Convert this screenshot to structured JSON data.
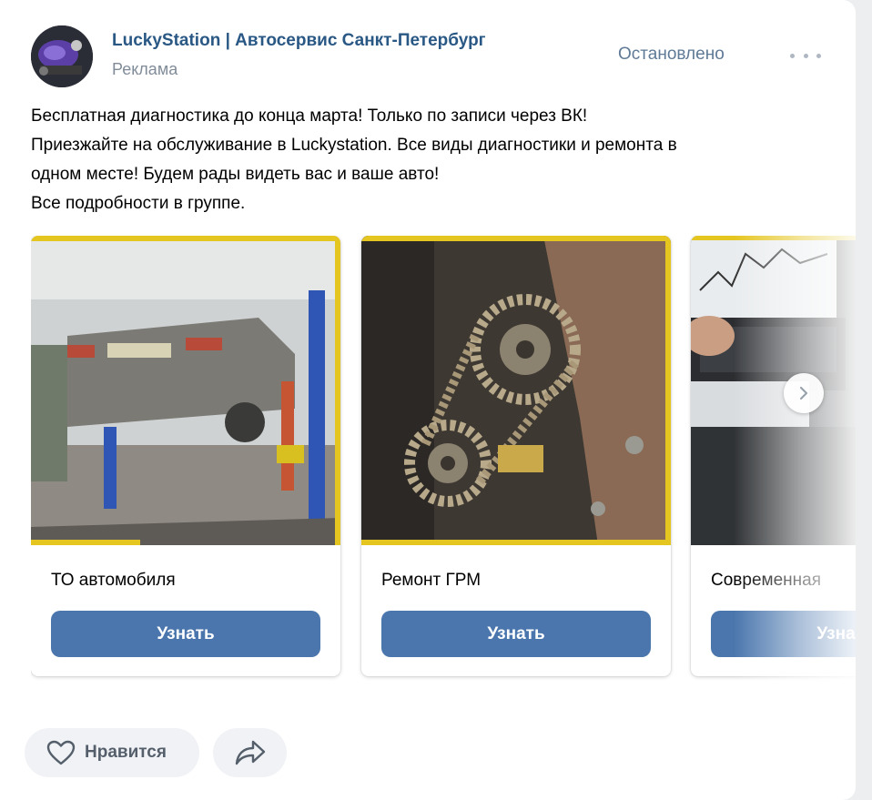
{
  "post": {
    "author": "LuckyStation | Автосервис Санкт-Петербург",
    "label": "Реклама",
    "status": "Остановлено",
    "text_lines": [
      "Бесплатная диагностика до конца марта! Только по записи через ВК!",
      "Приезжайте на обслуживание в Luckystation. Все виды диагностики и ремонта в",
      "одном месте! Будем рады видеть вас и ваше авто!",
      "Все подробности в группе."
    ]
  },
  "carousel": {
    "cards": [
      {
        "title": "ТО автомобиля",
        "button": "Узнать",
        "image": "car-on-lift-photo"
      },
      {
        "title": "Ремонт ГРМ",
        "button": "Узнать",
        "image": "timing-chain-photo"
      },
      {
        "title": "Современная",
        "button": "Узнать",
        "image": "laptop-diagnostics-photo"
      }
    ],
    "next_icon": "chevron-right-icon"
  },
  "actions": {
    "like_label": "Нравится",
    "like_icon": "heart-icon",
    "share_icon": "share-icon"
  },
  "colors": {
    "link": "#2a5885",
    "button": "#4a76ad",
    "secondary": "#818c99",
    "background": "#edeef0"
  }
}
